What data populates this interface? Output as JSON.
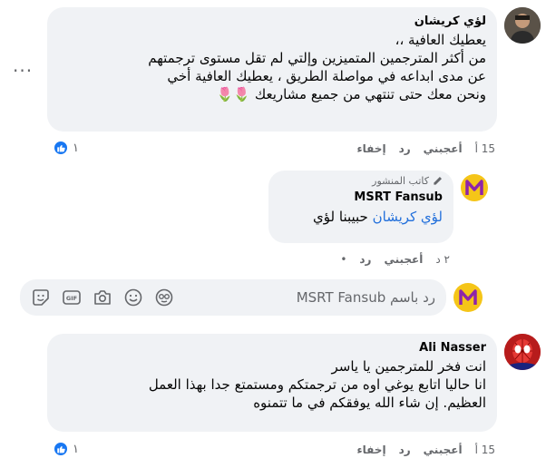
{
  "comment1": {
    "author": "لؤي كريشان",
    "lines": [
      "يعطيك العافية ،،",
      "من أكثر المترجمين المتميزين وإلتي لم تقل مستوى ترجمتهم",
      "عن مدى ابداعه في مواصلة الطريق ، يعطيك العافية أخي",
      "ونحن معك حتى تنتهي من جميع مشاريعك"
    ],
    "emoji": "🌷🌷",
    "time": "15 أ",
    "like_label": "أعجبني",
    "reply_label": "رد",
    "hide_label": "إخفاء",
    "reaction_count": "١",
    "more": "···"
  },
  "reply1": {
    "badge": "كاتب المنشور",
    "author": "MSRT Fansub",
    "mention": "لؤي كريشان",
    "text": "حبيبنا لؤي",
    "time": "٢ د",
    "like_label": "أعجبني",
    "reply_label": "رد",
    "sep": "•"
  },
  "composer": {
    "placeholder": "رد باسم MSRT Fansub"
  },
  "comment2": {
    "author": "Ali Nasser",
    "lines": [
      "انت فخر للمترجمين يا ياسر",
      "انا حاليا اتابع يوغي اوه من ترجمتكم ومستمتع جدا بهذا العمل",
      "العظيم. إن شاء الله يوفقكم في ما تتمنوه"
    ],
    "time": "15 أ",
    "like_label": "أعجبني",
    "reply_label": "رد",
    "hide_label": "إخفاء",
    "reaction_count": "١"
  },
  "colors": {
    "accent": "#1877f2",
    "bubble": "#f0f2f5",
    "link": "#216fdb",
    "msrt_logo_bg": "#f5c518",
    "msrt_logo_fg": "#8e24aa"
  },
  "icons": [
    "like-icon",
    "pencil-icon",
    "sticker-icon",
    "gif-icon",
    "camera-icon",
    "emoji-icon",
    "avatar-icon",
    "more-icon"
  ]
}
